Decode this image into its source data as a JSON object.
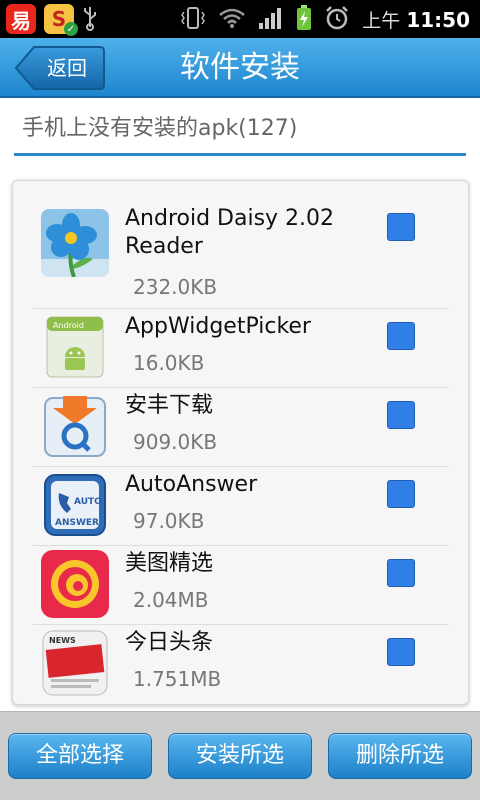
{
  "statusbar": {
    "time_prefix": "上午",
    "time": "11:50",
    "app1": "易",
    "app2": "S",
    "app2_badge": "✓",
    "icons": [
      "usb-icon",
      "vibrate-icon",
      "wifi-icon",
      "signal-icon",
      "battery-charging-icon",
      "alarm-icon"
    ]
  },
  "header": {
    "back_label": "返回",
    "title": "软件安装"
  },
  "summary": {
    "text": "手机上没有安装的apk(127)"
  },
  "apps": [
    {
      "name": "Android Daisy 2.02 Reader",
      "size": "232.0KB",
      "icon": "daisy-icon",
      "checked": true
    },
    {
      "name": "AppWidgetPicker",
      "size": "16.0KB",
      "icon": "android-apk-icon",
      "checked": true
    },
    {
      "name": "安丰下载",
      "size": "909.0KB",
      "icon": "anfeng-download-icon",
      "checked": true
    },
    {
      "name": "AutoAnswer",
      "size": "97.0KB",
      "icon": "auto-answer-icon",
      "checked": true
    },
    {
      "name": "美图精选",
      "size": "2.04MB",
      "icon": "meitu-icon",
      "checked": true
    },
    {
      "name": "今日头条",
      "size": "1.751MB",
      "icon": "toutiao-icon",
      "checked": true
    }
  ],
  "footer": {
    "select_all": "全部选择",
    "install_selected": "安装所选",
    "delete_selected": "删除所选"
  },
  "colors": {
    "accent": "#1e86cf",
    "checkbox": "#2f7fe6"
  }
}
